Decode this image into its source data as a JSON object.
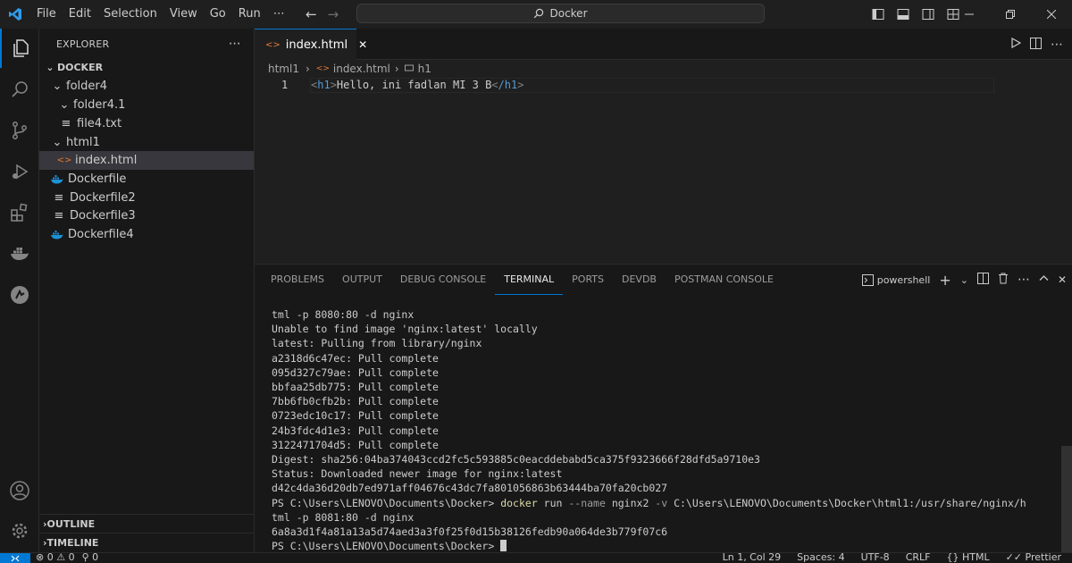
{
  "menu": [
    "File",
    "Edit",
    "Selection",
    "View",
    "Go",
    "Run"
  ],
  "search": {
    "text": "Docker"
  },
  "explorer": {
    "title": "EXPLORER",
    "root": "DOCKER",
    "items": [
      {
        "label": "folder4",
        "depth": 1,
        "kind": "folder",
        "expanded": true
      },
      {
        "label": "folder4.1",
        "depth": 2,
        "kind": "folder",
        "expanded": true
      },
      {
        "label": "file4.txt",
        "depth": 2,
        "kind": "text"
      },
      {
        "label": "html1",
        "depth": 1,
        "kind": "folder",
        "expanded": true
      },
      {
        "label": "index.html",
        "depth": 2,
        "kind": "html",
        "selected": true
      },
      {
        "label": "Dockerfile",
        "depth": 1,
        "kind": "docker"
      },
      {
        "label": "Dockerfile2",
        "depth": 1,
        "kind": "text"
      },
      {
        "label": "Dockerfile3",
        "depth": 1,
        "kind": "text"
      },
      {
        "label": "Dockerfile4",
        "depth": 1,
        "kind": "docker"
      }
    ],
    "outline": "OUTLINE",
    "timeline": "TIMELINE"
  },
  "editor": {
    "tab_label": "index.html",
    "breadcrumb": [
      "html1",
      "index.html",
      "h1"
    ],
    "line_number": "1",
    "code": {
      "open_tag": "h1",
      "text": "Hello, ini fadlan MI 3 B",
      "close_tag": "/h1"
    }
  },
  "panel": {
    "tabs": [
      "PROBLEMS",
      "OUTPUT",
      "DEBUG CONSOLE",
      "TERMINAL",
      "PORTS",
      "DEVDB",
      "POSTMAN CONSOLE"
    ],
    "active_tab": "TERMINAL",
    "shell": "powershell",
    "terminal": {
      "lines_before": [
        "tml -p 8080:80 -d nginx",
        "Unable to find image 'nginx:latest' locally",
        "latest: Pulling from library/nginx",
        "a2318d6c47ec: Pull complete",
        "095d327c79ae: Pull complete",
        "bbfaa25db775: Pull complete",
        "7bb6fb0cfb2b: Pull complete",
        "0723edc10c17: Pull complete",
        "24b3fdc4d1e3: Pull complete",
        "3122471704d5: Pull complete",
        "Digest: sha256:04ba374043ccd2fc5c593885c0eacddebabd5ca375f9323666f28dfd5a9710e3",
        "Status: Downloaded newer image for nginx:latest",
        "d42c4da36d20db7ed971aff04676c43dc7fa801056863b63444ba70fa20cb027"
      ],
      "prompt": "PS C:\\Users\\LENOVO\\Documents\\Docker> ",
      "cmd": "docker",
      "cmd_rest_1": " run ",
      "cmd_flag_1": "--name",
      "cmd_rest_2": " nginx2 ",
      "cmd_flag_2": "-v",
      "cmd_rest_3": " C:\\Users\\LENOVO\\Documents\\Docker\\html1:/usr/share/nginx/h",
      "lines_after": [
        "tml -p 8081:80 -d nginx",
        "6a8a3d1f4a81a13a5d74aed3a3f0f25f0d15b38126fedb90a064de3b779f07c6"
      ],
      "final_prompt": "PS C:\\Users\\LENOVO\\Documents\\Docker> "
    }
  },
  "status": {
    "errors": "0",
    "warnings": "0",
    "ports": "0",
    "position": "Ln 1, Col 29",
    "spaces": "Spaces: 4",
    "encoding": "UTF-8",
    "eol": "CRLF",
    "language": "HTML",
    "formatter": "Prettier"
  },
  "colors": {
    "accent": "#0078d4",
    "html_icon": "#e37933",
    "docker_icon": "#1d91d6"
  }
}
